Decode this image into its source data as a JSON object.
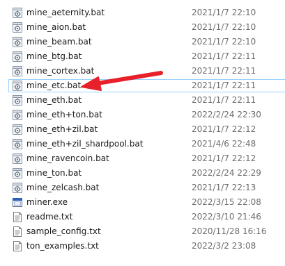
{
  "files": [
    {
      "name": "mine_aeternity.bat",
      "modified": "2021/1/7 22:10",
      "icon": "bat-file-icon"
    },
    {
      "name": "mine_aion.bat",
      "modified": "2021/1/7 22:10",
      "icon": "bat-file-icon"
    },
    {
      "name": "mine_beam.bat",
      "modified": "2021/1/7 22:10",
      "icon": "bat-file-icon"
    },
    {
      "name": "mine_btg.bat",
      "modified": "2021/1/7 22:11",
      "icon": "bat-file-icon"
    },
    {
      "name": "mine_cortex.bat",
      "modified": "2021/1/7 22:11",
      "icon": "bat-file-icon"
    },
    {
      "name": "mine_etc.bat",
      "modified": "2021/1/7 22:11",
      "icon": "bat-file-icon",
      "selected": true
    },
    {
      "name": "mine_eth.bat",
      "modified": "2021/1/7 22:11",
      "icon": "bat-file-icon"
    },
    {
      "name": "mine_eth+ton.bat",
      "modified": "2022/2/24 22:30",
      "icon": "bat-file-icon"
    },
    {
      "name": "mine_eth+zil.bat",
      "modified": "2021/1/7 22:12",
      "icon": "bat-file-icon"
    },
    {
      "name": "mine_eth+zil_shardpool.bat",
      "modified": "2021/4/6 22:48",
      "icon": "bat-file-icon"
    },
    {
      "name": "mine_ravencoin.bat",
      "modified": "2021/1/7 22:12",
      "icon": "bat-file-icon"
    },
    {
      "name": "mine_ton.bat",
      "modified": "2022/2/24 22:29",
      "icon": "bat-file-icon"
    },
    {
      "name": "mine_zelcash.bat",
      "modified": "2021/1/7 22:13",
      "icon": "bat-file-icon"
    },
    {
      "name": "miner.exe",
      "modified": "2022/3/15 22:08",
      "icon": "exe-file-icon"
    },
    {
      "name": "readme.txt",
      "modified": "2022/3/10 21:46",
      "icon": "txt-file-icon"
    },
    {
      "name": "sample_config.txt",
      "modified": "2020/11/28 16:16",
      "icon": "txt-file-icon"
    },
    {
      "name": "ton_examples.txt",
      "modified": "2022/3/2 23:08",
      "icon": "txt-file-icon"
    }
  ],
  "annotation": {
    "arrow_color": "#e8202a",
    "points_to": "mine_etc.bat"
  },
  "colors": {
    "selection_border": "#99d1ff",
    "date_text": "#6d6d6d"
  }
}
